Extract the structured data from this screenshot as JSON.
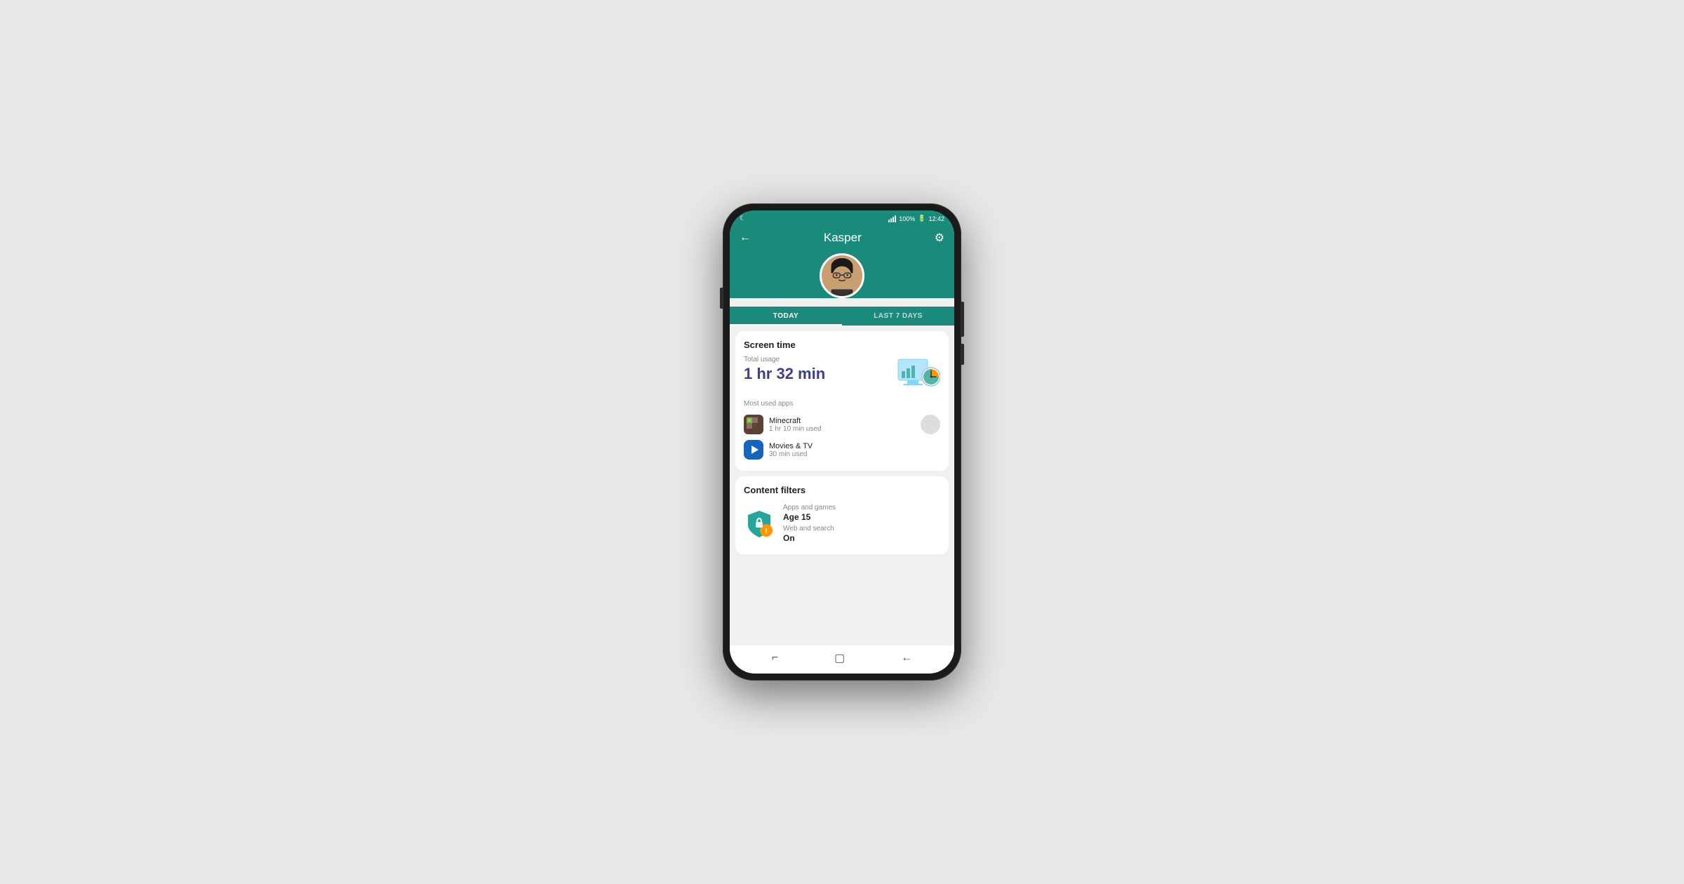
{
  "status_bar": {
    "time": "12:42",
    "battery": "100%",
    "moon": "☾"
  },
  "header": {
    "back_label": "←",
    "title": "Kasper",
    "settings_label": "⚙"
  },
  "tabs": [
    {
      "id": "today",
      "label": "TODAY",
      "active": true
    },
    {
      "id": "last7",
      "label": "LAST 7 DAYS",
      "active": false
    }
  ],
  "screen_time": {
    "section_title": "Screen time",
    "total_usage_label": "Total usage",
    "total_usage_value": "1 hr 32 min",
    "most_used_label": "Most used apps",
    "apps": [
      {
        "name": "Minecraft",
        "time": "1 hr 10 min used",
        "icon_type": "minecraft"
      },
      {
        "name": "Movies & TV",
        "time": "30 min used",
        "icon_type": "movies"
      }
    ]
  },
  "content_filters": {
    "section_title": "Content filters",
    "apps_games_label": "Apps and games",
    "apps_games_value": "Age 15",
    "web_search_label": "Web and search",
    "web_search_value": "On"
  },
  "bottom_nav": {
    "recents": "⌐",
    "home": "▢",
    "back": "←"
  }
}
